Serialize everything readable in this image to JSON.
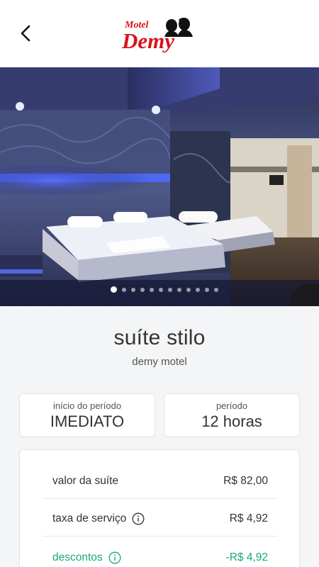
{
  "header": {
    "logo_top": "Motel",
    "logo_main": "Demy"
  },
  "gallery": {
    "total_images": 12,
    "active_index": 0
  },
  "suite": {
    "name": "suíte stilo",
    "motel": "demy motel"
  },
  "period": {
    "start_label": "início do período",
    "start_value": "IMEDIATO",
    "duration_label": "período",
    "duration_value": "12 horas"
  },
  "pricing": {
    "suite_label": "valor da suíte",
    "suite_value": "R$ 82,00",
    "fee_label": "taxa de serviço",
    "fee_value": "R$ 4,92",
    "discount_label": "descontos",
    "discount_value": "-R$ 4,92"
  },
  "colors": {
    "brand_red": "#d9121b",
    "discount_green": "#1aa87a",
    "neon_blue": "#3b5bff"
  }
}
